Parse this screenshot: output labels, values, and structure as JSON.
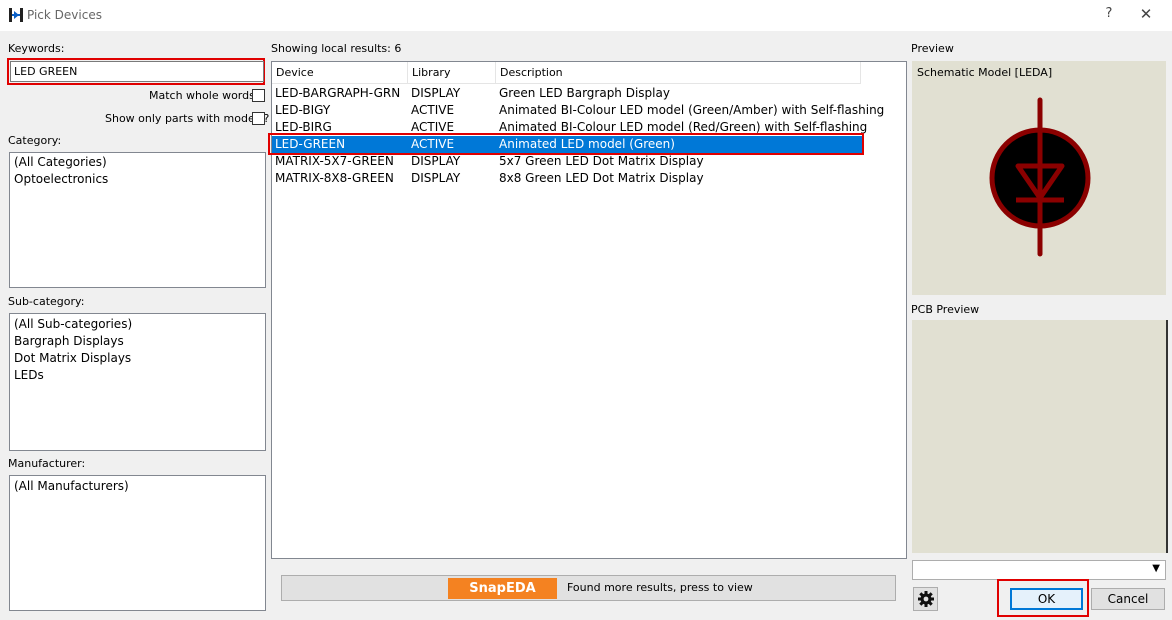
{
  "window": {
    "title": "Pick Devices",
    "help_label": "?",
    "close_label": "✕"
  },
  "keywords": {
    "label": "Keywords:",
    "value": "LED GREEN",
    "match_whole_words_label": "Match whole words?",
    "match_whole_words_checked": false,
    "show_only_models_label": "Show only parts with models?",
    "show_only_models_checked": false
  },
  "category": {
    "label": "Category:",
    "items": [
      "(All Categories)",
      "Optoelectronics"
    ]
  },
  "subcategory": {
    "label": "Sub-category:",
    "items": [
      "(All Sub-categories)",
      "Bargraph Displays",
      "Dot Matrix Displays",
      "LEDs"
    ]
  },
  "manufacturer": {
    "label": "Manufacturer:",
    "items": [
      "(All Manufacturers)"
    ]
  },
  "results": {
    "label": "Showing local results: 6",
    "columns": [
      "Device",
      "Library",
      "Description"
    ],
    "rows": [
      {
        "device": "LED-BARGRAPH-GRN",
        "library": "DISPLAY",
        "description": "Green LED Bargraph Display"
      },
      {
        "device": "LED-BIGY",
        "library": "ACTIVE",
        "description": "Animated BI-Colour LED model (Green/Amber) with Self-flashing"
      },
      {
        "device": "LED-BIRG",
        "library": "ACTIVE",
        "description": "Animated BI-Colour LED model (Red/Green) with Self-flashing"
      },
      {
        "device": "LED-GREEN",
        "library": "ACTIVE",
        "description": "Animated LED model (Green)"
      },
      {
        "device": "MATRIX-5X7-GREEN",
        "library": "DISPLAY",
        "description": "5x7 Green LED Dot Matrix Display"
      },
      {
        "device": "MATRIX-8X8-GREEN",
        "library": "DISPLAY",
        "description": "8x8 Green LED Dot Matrix Display"
      }
    ],
    "selected_index": 3
  },
  "snapeda": {
    "logo_text": "SnapEDA",
    "message": "Found more results, press to view"
  },
  "preview": {
    "label": "Preview",
    "schematic_title": "Schematic Model [LEDA]",
    "pcb_label": "PCB Preview"
  },
  "buttons": {
    "ok": "OK",
    "cancel": "Cancel"
  },
  "colors": {
    "selection": "#0078d7",
    "highlight_red": "#e00000",
    "preview_bg": "#e1e0d2",
    "led_dark_red": "#8b0000",
    "snapeda_orange": "#f48221"
  },
  "icons": [
    "app-icon",
    "gear-icon",
    "chevron-down-icon",
    "close-icon",
    "help-icon"
  ]
}
